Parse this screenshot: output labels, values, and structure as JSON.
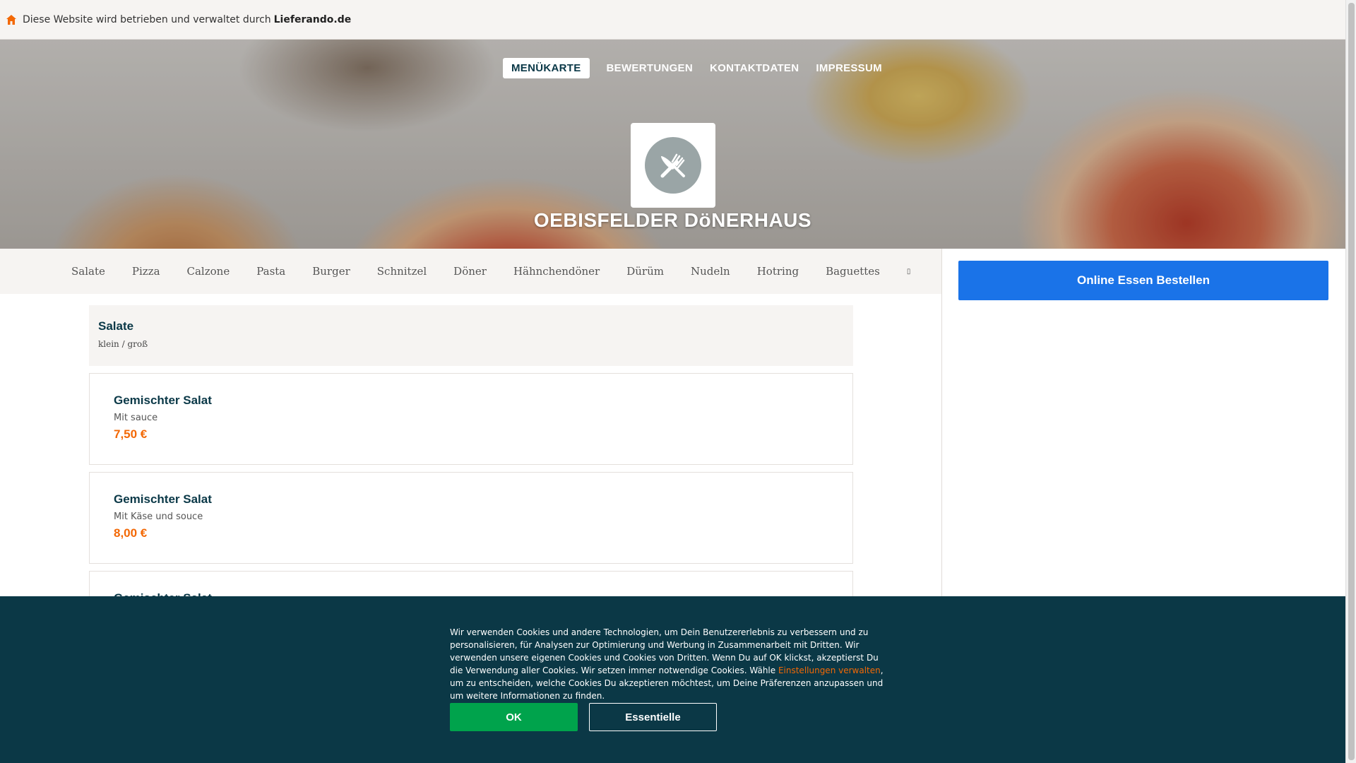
{
  "topbar": {
    "text": "Diese Website wird betrieben und verwaltet durch",
    "brand": "Lieferando.de"
  },
  "nav": {
    "items": [
      "MENÜKARTE",
      "BEWERTUNGEN",
      "KONTAKTDATEN",
      "IMPRESSUM"
    ],
    "active": "MENÜKARTE"
  },
  "restaurant": {
    "name": "OEBISFELDER DöNERHAUS",
    "logo_icon": "cutlery-icon"
  },
  "categories": [
    "Salate",
    "Pizza",
    "Calzone",
    "Pasta",
    "Burger",
    "Schnitzel",
    "Döner",
    "Hähnchendöner",
    "Dürüm",
    "Nudeln",
    "Hotring",
    "Baguettes"
  ],
  "sidebar": {
    "order_button": "Online Essen Bestellen"
  },
  "menu": {
    "section": {
      "title": "Salate",
      "subtitle": "klein / groß"
    },
    "dishes": [
      {
        "name": "Gemischter Salat",
        "description": "Mit sauce",
        "price": "7,50 €"
      },
      {
        "name": "Gemischter Salat",
        "description": "Mit Käse und souce",
        "price": "8,00 €"
      },
      {
        "name": "Gemischter Salat",
        "description": "",
        "price": ""
      }
    ]
  },
  "cookie": {
    "text_before_link": "Wir verwenden Cookies und andere Technologien, um Dein Benutzererlebnis zu verbessern und zu personalisieren, für Analysen zur Optimierung und Werbung in Zusammenarbeit mit Dritten. Wir verwenden unsere eigenen Cookies und Cookies von Dritten. Wenn Du auf OK klickst, akzeptierst Du die Verwendung aller Cookies. Wir setzen immer notwendige Cookies. Wähle ",
    "link": "Einstellungen verwalten",
    "text_after_link": ", um zu entscheiden, welche Cookies Du akzeptieren möchtest, um Deine Präferenzen anzupassen und um weitere Informationen zu finden.",
    "ok_label": "OK",
    "essential_label": "Essentielle"
  },
  "colors": {
    "accent_orange": "#f36805",
    "order_blue": "#1a73e8",
    "cookie_bg": "#0b3846",
    "ok_green": "#00a34c"
  }
}
